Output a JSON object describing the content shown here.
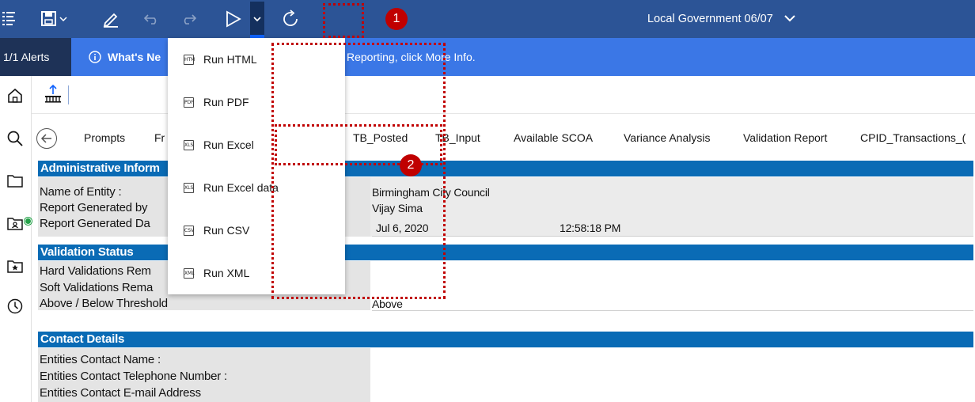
{
  "toolbar": {
    "package_title": "Local Government 06/07",
    "icons": [
      "contents-icon",
      "save-icon",
      "edit-icon",
      "undo-icon",
      "redo-icon",
      "run-icon",
      "refresh-icon"
    ]
  },
  "alerts": {
    "count_label": "1/1 Alerts",
    "info_bold": "What's Ne",
    "info_rest": "Reporting, click More Info."
  },
  "tabs": {
    "items": [
      "Prompts",
      "Fr",
      "TB_Posted",
      "TB_Input",
      "Available SCOA",
      "Variance Analysis",
      "Validation Report",
      "CPID_Transactions_("
    ]
  },
  "run_menu": {
    "items": [
      {
        "label": "Run HTML",
        "icon_text": "HTM"
      },
      {
        "label": "Run PDF",
        "icon_text": "PDF"
      },
      {
        "label": "Run Excel",
        "icon_text": "XLS"
      },
      {
        "label": "Run Excel data",
        "icon_text": "XLS"
      },
      {
        "label": "Run CSV",
        "icon_text": "CSV"
      },
      {
        "label": "Run XML",
        "icon_text": "XML"
      }
    ]
  },
  "report": {
    "admin_header": "Administrative Inform",
    "name_label": "Name of Entity :",
    "generated_by_label": "Report Generated by",
    "generated_date_label": "Report Generated Da",
    "entity_name": "Birmingham City Council",
    "generated_by": "Vijay Sima",
    "generated_date": "Jul 6, 2020",
    "generated_time": "12:58:18 PM",
    "validation_header": "Validation Status",
    "hard_label": "Hard Validations Rem",
    "soft_label": "Soft Validations Rema",
    "threshold_label": "Above / Below Threshold",
    "threshold_value": "Above",
    "contact_header": "Contact Details",
    "contact_name_label": "Entities Contact Name :",
    "contact_phone_label": "Entities Contact Telephone Number :",
    "contact_email_label": "Entities Contact E-mail Address"
  },
  "callouts": [
    "1",
    "2"
  ],
  "colors": {
    "toolbar_bg": "#2c5496",
    "alert_bg": "#3b77e6",
    "section_header": "#0a6bb5",
    "callout_red": "#c00000"
  }
}
